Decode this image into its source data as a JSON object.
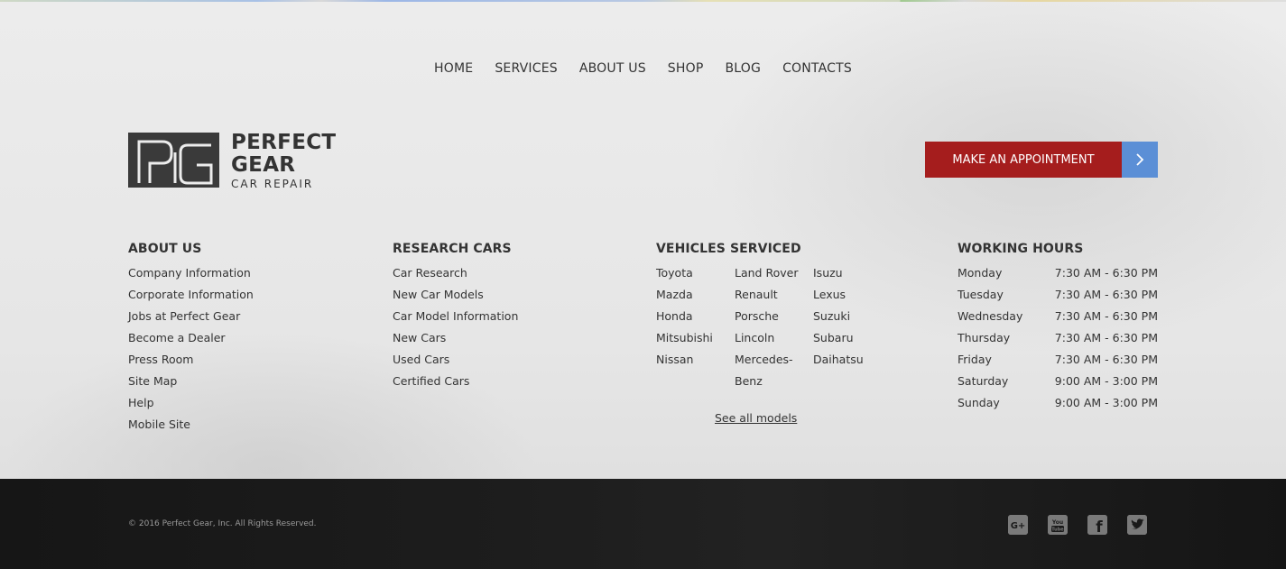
{
  "nav": {
    "items": [
      "HOME",
      "SERVICES",
      "ABOUT US",
      "SHOP",
      "BLOG",
      "CONTACTS"
    ]
  },
  "logo": {
    "line1": "PERFECT",
    "line2": "GEAR",
    "line3": "CAR REPAIR"
  },
  "appointment": {
    "label": "MAKE AN APPOINTMENT"
  },
  "about": {
    "title": "ABOUT US",
    "items": [
      "Company Information",
      "Corporate Information",
      "Jobs at Perfect Gear",
      "Become a Dealer",
      "Press Room",
      "Site Map",
      "Help",
      "Mobile Site"
    ]
  },
  "research": {
    "title": "RESEARCH CARS",
    "items": [
      "Car Research",
      "New Car Models",
      "Car Model Information",
      "New Cars",
      "Used Cars",
      "Certified Cars"
    ]
  },
  "vehicles": {
    "title": "VEHICLES SERVICED",
    "col1": [
      "Toyota",
      "Mazda",
      "Honda",
      "Mitsubishi",
      "Nissan"
    ],
    "col2": [
      "Land Rover",
      "Renault",
      "Porsche",
      "Lincoln",
      "Mercedes-Benz"
    ],
    "col3": [
      "Isuzu",
      "Lexus",
      "Suzuki",
      "Subaru",
      "Daihatsu"
    ],
    "see_all": "See all models"
  },
  "hours": {
    "title": "WORKING HOURS",
    "rows": [
      {
        "day": "Monday",
        "time": "7:30 AM - 6:30 PM"
      },
      {
        "day": "Tuesday",
        "time": "7:30 AM - 6:30 PM"
      },
      {
        "day": "Wednesday",
        "time": "7:30 AM - 6:30 PM"
      },
      {
        "day": "Thursday",
        "time": "7:30 AM - 6:30 PM"
      },
      {
        "day": "Friday",
        "time": "7:30 AM - 6:30 PM"
      },
      {
        "day": "Saturday",
        "time": "9:00 AM - 3:00 PM"
      },
      {
        "day": "Sunday",
        "time": "9:00 AM - 3:00 PM"
      }
    ]
  },
  "footer": {
    "copyright": "© 2016 Perfect Gear, Inc. All Rights Reserved.",
    "social": [
      {
        "icon": "google-plus-icon",
        "glyph": "G+"
      },
      {
        "icon": "youtube-icon",
        "glyph": "You\nTube"
      },
      {
        "icon": "facebook-icon",
        "glyph": "f"
      },
      {
        "icon": "twitter-icon",
        "glyph": "t"
      }
    ]
  },
  "colors": {
    "accent_red": "#a51d1d",
    "accent_blue": "#5b8fd6",
    "text": "#333333",
    "footer_bg": "#1a1a1a"
  }
}
